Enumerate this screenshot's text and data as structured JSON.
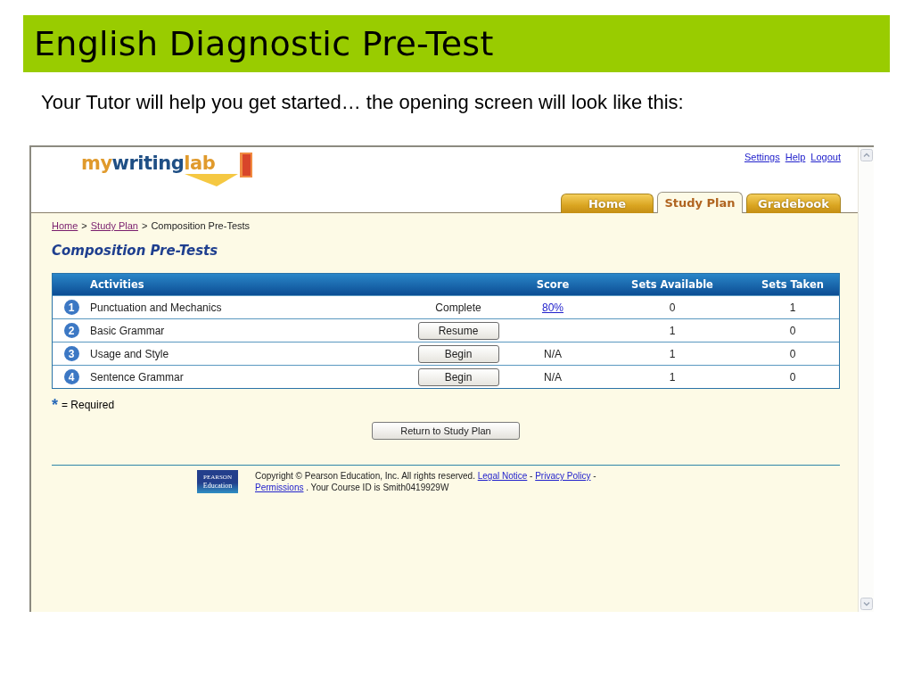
{
  "slide": {
    "title": "English Diagnostic Pre-Test",
    "subtitle": "Your Tutor will help you get started… the opening screen will look like this:"
  },
  "app": {
    "logo": [
      {
        "text": "my",
        "kind": "accent"
      },
      {
        "text": "writing",
        "kind": "main"
      },
      {
        "text": "lab",
        "kind": "accent"
      }
    ],
    "top_links": [
      "Settings",
      "Help",
      "Logout"
    ],
    "tabs": [
      {
        "label": "Home",
        "selected": false
      },
      {
        "label": "Study Plan",
        "selected": true
      },
      {
        "label": "Gradebook",
        "selected": false
      }
    ],
    "breadcrumb": {
      "links": [
        "Home",
        "Study Plan"
      ],
      "separator": ">",
      "current": "Composition Pre-Tests"
    },
    "heading": "Composition Pre-Tests",
    "table": {
      "columns": [
        "Activities",
        "Score",
        "Sets Available",
        "Sets Taken"
      ],
      "rows": [
        {
          "number": "1",
          "activity": "Punctuation and Mechanics",
          "status": {
            "kind": "text",
            "label": "Complete"
          },
          "score": {
            "text": "80%",
            "link": true
          },
          "sets_available": "0",
          "sets_taken": "1"
        },
        {
          "number": "2",
          "activity": "Basic Grammar",
          "status": {
            "kind": "button",
            "label": "Resume"
          },
          "sets_available": "1",
          "sets_taken": "0"
        },
        {
          "number": "3",
          "activity": "Usage and Style",
          "status": {
            "kind": "button",
            "label": "Begin"
          },
          "score": {
            "text": "N/A",
            "link": false
          },
          "sets_available": "1",
          "sets_taken": "0"
        },
        {
          "number": "4",
          "activity": "Sentence Grammar",
          "status": {
            "kind": "button",
            "label": "Begin"
          },
          "score": {
            "text": "N/A",
            "link": false
          },
          "sets_available": "1",
          "sets_taken": "0"
        }
      ]
    },
    "required_note": {
      "mark": "*",
      "text": "= Required"
    },
    "return_button": "Return to Study Plan",
    "footer": {
      "publisher_logo": [
        "PEARSON",
        "Education"
      ],
      "copyright": "Copyright © Pearson Education, Inc. All rights reserved.",
      "links": [
        "Legal Notice",
        "Privacy Policy",
        "Permissions"
      ],
      "separator": "-",
      "course_id": ". Your Course ID is Smith0419929W"
    }
  }
}
